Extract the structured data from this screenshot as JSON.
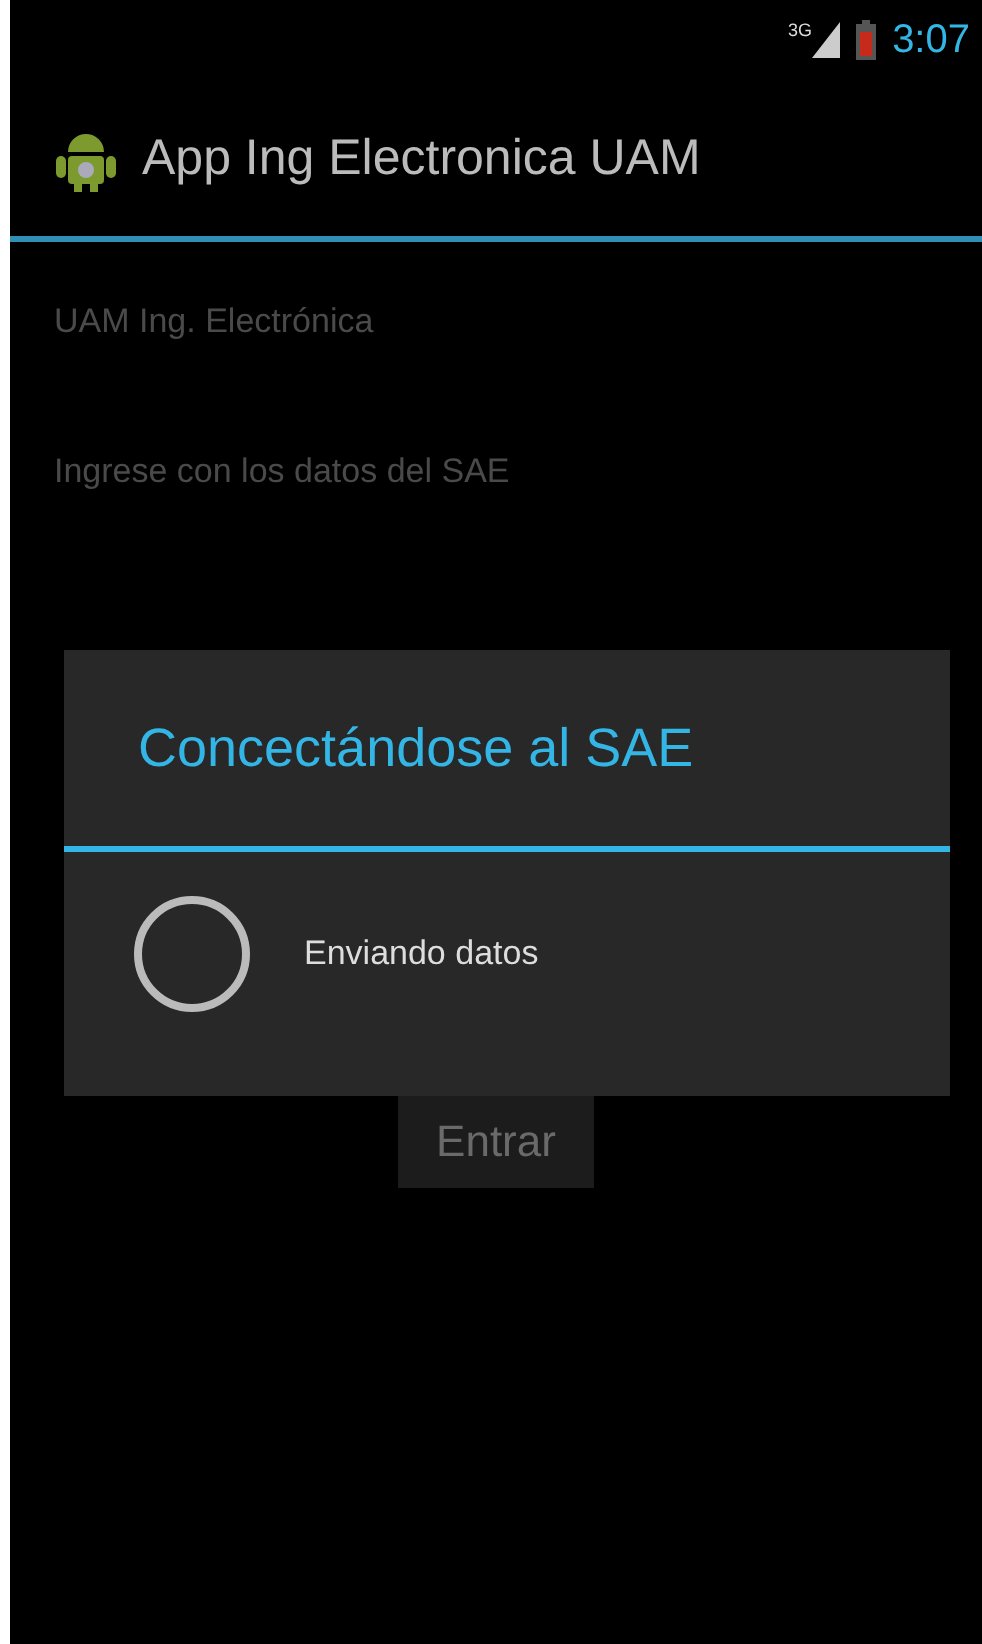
{
  "status_bar": {
    "network": "3G",
    "time": "3:07"
  },
  "action_bar": {
    "title": "App Ing Electronica UAM"
  },
  "content": {
    "heading": "UAM Ing. Electrónica",
    "instruction": "Ingrese con los datos del SAE",
    "button": "Entrar"
  },
  "dialog": {
    "title": "Concectándose al SAE",
    "message": "Enviando datos"
  }
}
